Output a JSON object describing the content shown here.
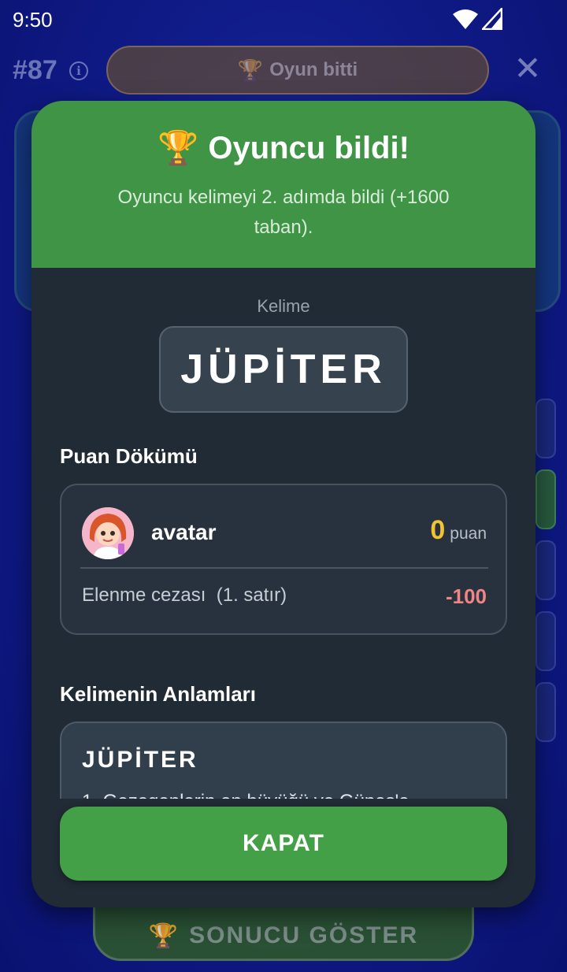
{
  "status_bar": {
    "time": "9:50",
    "icons": [
      "wifi-icon",
      "signal-icon"
    ]
  },
  "game_header": {
    "game_number": "#87",
    "info_icon": "info-icon",
    "status_pill_icon": "trophy-icon",
    "status_pill_label": "Oyun bitti",
    "close_icon": "close-icon"
  },
  "background": {
    "action_button_label": "SONUCU GÖSTER",
    "action_button_icon": "trophy-icon"
  },
  "modal": {
    "title_icon": "🏆",
    "title": "Oyuncu bildi!",
    "subtitle": "Oyuncu kelimeyi 2. adımda bildi (+1600 taban).",
    "word_caption": "Kelime",
    "word": "JÜPİTER",
    "score_section_title": "Puan Dökümü",
    "score": {
      "player_name": "avatar",
      "points": "0",
      "points_unit": "puan",
      "penalty_label": "Elenme cezası  (1. satır)",
      "penalty_value": "-100"
    },
    "meanings_section_title": "Kelimenin Anlamları",
    "meaning": {
      "word": "JÜPİTER",
      "definition": "1. Gezegenlerin en büyüğü ve Güneş'e"
    },
    "close_button_label": "KAPAT"
  },
  "colors": {
    "header_green": "#3f9445",
    "button_green": "#43a047",
    "points_gold": "#f1c232",
    "penalty_red": "#f08585",
    "modal_bg": "#212b35"
  }
}
